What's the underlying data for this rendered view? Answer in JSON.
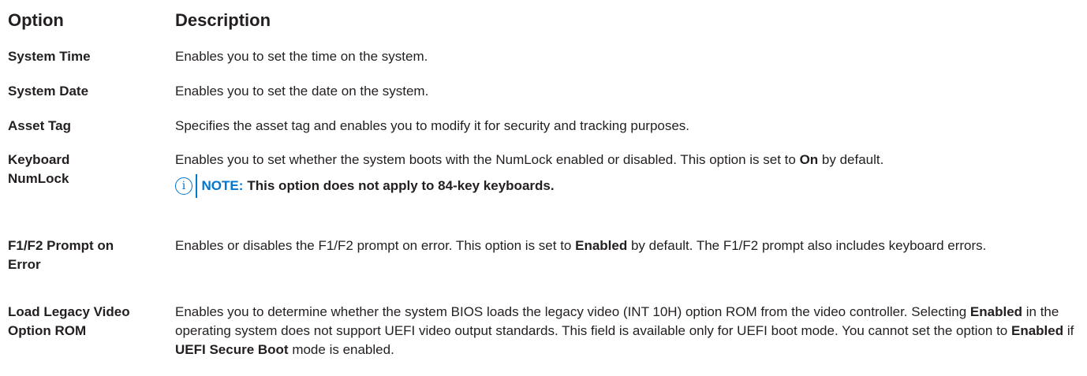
{
  "headers": {
    "option": "Option",
    "description": "Description"
  },
  "rows": [
    {
      "option": "System Time",
      "description": "Enables you to set the time on the system."
    },
    {
      "option": "System Date",
      "description": "Enables you to set the date on the system."
    },
    {
      "option": "Asset Tag",
      "description": "Specifies the asset tag and enables you to modify it for security and tracking purposes."
    },
    {
      "option_line1": "Keyboard",
      "option_line2": "NumLock",
      "desc_a": "Enables you to set whether the system boots with the NumLock enabled or disabled. This option is set to ",
      "desc_b": "On",
      "desc_c": " by default.",
      "note_icon": "info-icon",
      "note_label": "NOTE:",
      "note_text": "This option does not apply to 84-key keyboards."
    },
    {
      "option_line1": "F1/F2 Prompt on",
      "option_line2": "Error",
      "desc_a": "Enables or disables the F1/F2 prompt on error. This option is set to ",
      "desc_b": "Enabled",
      "desc_c": " by default. The F1/F2 prompt also includes keyboard errors."
    },
    {
      "option_line1": "Load Legacy Video",
      "option_line2": "Option ROM",
      "desc_a": "Enables you to determine whether the system BIOS loads the legacy video (INT 10H) option ROM from the video controller. Selecting ",
      "desc_b": "Enabled",
      "desc_c": " in the operating system does not support UEFI video output standards. This field is available only for UEFI boot mode. You cannot set the option to ",
      "desc_d": "Enabled",
      "desc_e": " if ",
      "desc_f": "UEFI Secure Boot",
      "desc_g": " mode is enabled."
    }
  ],
  "colors": {
    "text": "#231f20",
    "note_accent": "#0076ce",
    "background": "#ffffff"
  }
}
